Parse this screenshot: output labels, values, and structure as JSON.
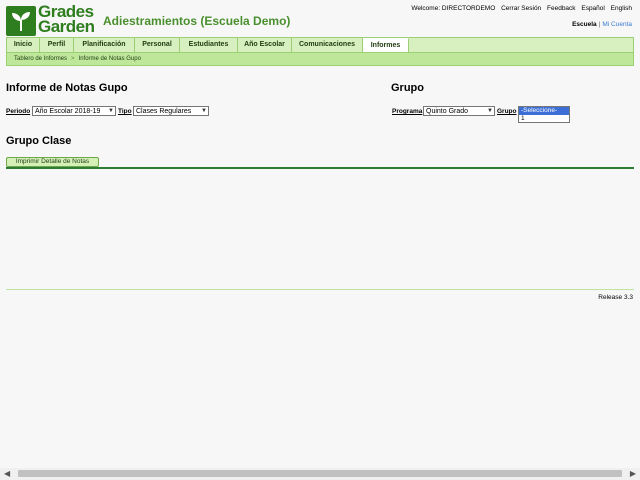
{
  "brand": {
    "line1": "Grades",
    "line2": "Garden"
  },
  "app_title": "Adiestramientos (Escuela Demo)",
  "top_links": {
    "welcome": "Welcome: DIRECTORDEMO",
    "logout": "Cerrar Sesión",
    "feedback": "Feedback",
    "espanol": "Español",
    "english": "English"
  },
  "account_links": {
    "escuela": "Escuela",
    "separator": "|",
    "mi_cuenta": "Mi Cuenta"
  },
  "nav": {
    "items": [
      "Inicio",
      "Perfil",
      "Planificación",
      "Personal",
      "Estudiantes",
      "Año Escolar",
      "Comunicaciones",
      "Informes"
    ],
    "active": "Informes"
  },
  "breadcrumb": {
    "parent": "Tablero de Informes",
    "arrow": ">",
    "current": "Informe de Notas Gupo"
  },
  "left_panel": {
    "title": "Informe de Notas Gupo",
    "periodo_label": "Periodo",
    "periodo_value": "Año Escolar 2018-19",
    "tipo_label": "Tipo",
    "tipo_value": "Clases Regulares"
  },
  "right_panel": {
    "title": "Grupo",
    "programa_label": "Programa",
    "programa_value": "Quinto Grado",
    "grupo_label": "Grupo",
    "grupo_options": [
      "-Seleccione-",
      "1"
    ]
  },
  "clase_section": {
    "title": "Grupo Clase",
    "print_button": "Imprimir Detalle de Notas"
  },
  "footer": {
    "release": "Release 3.3"
  },
  "icons": {
    "logo": "sprout-icon",
    "caret": "chevron-down-icon"
  },
  "colors": {
    "brand_green": "#2e7d1e",
    "nav_bg": "#d8f0bf",
    "accent": "#3b6fd6"
  }
}
